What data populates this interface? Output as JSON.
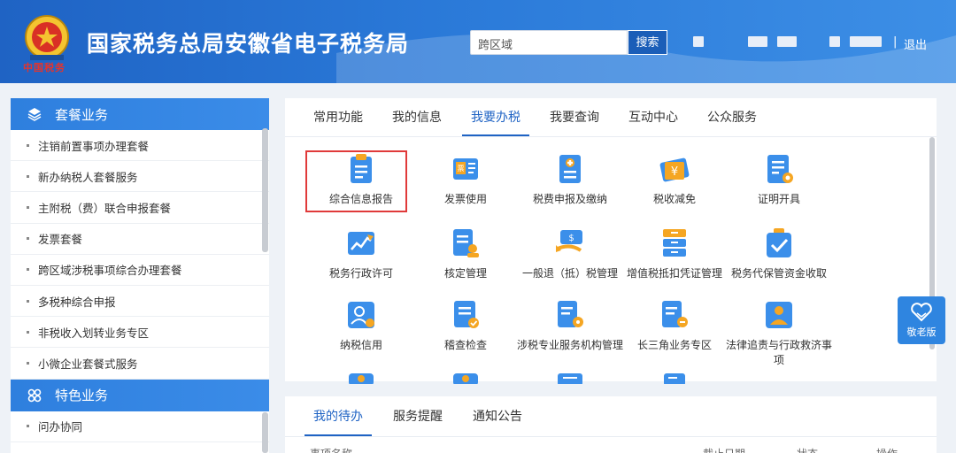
{
  "header": {
    "emblem_caption": "中国税务",
    "title": "国家税务总局安徽省电子税务局",
    "search_placeholder": "跨区域",
    "search_button": "搜索",
    "separator": "|",
    "logout": "退出"
  },
  "sidebar": {
    "section1_title": "套餐业务",
    "items": [
      {
        "label": "注销前置事项办理套餐"
      },
      {
        "label": "新办纳税人套餐服务"
      },
      {
        "label": "主附税（费）联合申报套餐"
      },
      {
        "label": "发票套餐"
      },
      {
        "label": "跨区域涉税事项综合办理套餐"
      },
      {
        "label": "多税种综合申报"
      },
      {
        "label": "非税收入划转业务专区"
      },
      {
        "label": "小微企业套餐式服务"
      }
    ],
    "section2_title": "特色业务",
    "items2": [
      {
        "label": "问办协同"
      }
    ]
  },
  "main": {
    "tabs": [
      {
        "label": "常用功能"
      },
      {
        "label": "我的信息"
      },
      {
        "label": "我要办税"
      },
      {
        "label": "我要查询"
      },
      {
        "label": "互动中心"
      },
      {
        "label": "公众服务"
      }
    ],
    "active_tab": "我要办税",
    "tiles": [
      {
        "label": "综合信息报告",
        "icon": "report-icon"
      },
      {
        "label": "发票使用",
        "icon": "invoice-icon"
      },
      {
        "label": "税费申报及缴纳",
        "icon": "declare-icon"
      },
      {
        "label": "税收减免",
        "icon": "tax-reduction-icon"
      },
      {
        "label": "证明开具",
        "icon": "certificate-icon"
      },
      {
        "label": "税务行政许可",
        "icon": "permit-icon"
      },
      {
        "label": "核定管理",
        "icon": "verify-icon"
      },
      {
        "label": "一般退（抵）税管理",
        "icon": "refund-icon"
      },
      {
        "label": "增值税抵扣凭证管理",
        "icon": "vat-deduction-icon"
      },
      {
        "label": "税务代保管资金收取",
        "icon": "custody-fund-icon"
      },
      {
        "label": "纳税信用",
        "icon": "credit-icon"
      },
      {
        "label": "稽查检查",
        "icon": "inspection-icon"
      },
      {
        "label": "涉税专业服务机构管理",
        "icon": "agency-icon"
      },
      {
        "label": "长三角业务专区",
        "icon": "yangtze-icon"
      },
      {
        "label": "法律追责与行政救济事项",
        "icon": "legal-icon"
      }
    ]
  },
  "elder_mode": {
    "label": "敬老版"
  },
  "bottom": {
    "tabs": [
      {
        "label": "我的待办"
      },
      {
        "label": "服务提醒"
      },
      {
        "label": "通知公告"
      }
    ],
    "active_tab": "我的待办",
    "columns": [
      "事项名称",
      "截止日期",
      "状态",
      "操作"
    ]
  },
  "colors": {
    "header_blue": "#2a79d8",
    "accent_blue": "#1f63c4",
    "highlight_red": "#e03a3a",
    "tile_blue": "#3b8fea",
    "tile_orange": "#f5a623"
  }
}
